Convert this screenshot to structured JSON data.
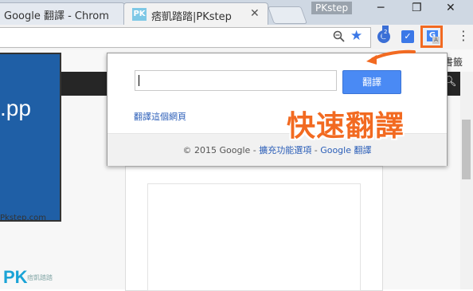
{
  "browser": {
    "tabs": [
      {
        "title": "Google 翻譯 - Chrom"
      },
      {
        "title": "痞凱踏踏|PKstep",
        "favicon": "PK"
      }
    ],
    "profile_badge": "PKstep",
    "window_controls": {
      "minimize": "─",
      "restore": "❐",
      "close": "✕"
    }
  },
  "toolbar": {
    "zoom_icon": "magnifier-icon",
    "star_icon": "star-icon",
    "translate_ext_letter": "G",
    "translate_ext_sub": "A"
  },
  "page": {
    "bookmark_text": "書籤",
    "banner_text": ".pp",
    "banner_caption": "Pkstep.com",
    "logo": "PK",
    "logo_sub": "痞凱踏踏"
  },
  "popup": {
    "input_value": "",
    "translate_button": "翻譯",
    "translate_page_link": "翻譯這個網頁",
    "footer_copyright": "© 2015 Google - ",
    "footer_options": "擴充功能選項",
    "footer_sep": " - ",
    "footer_google_translate": "Google 翻譯"
  },
  "annotation": {
    "text": "快速翻譯",
    "color": "#f26a21"
  }
}
